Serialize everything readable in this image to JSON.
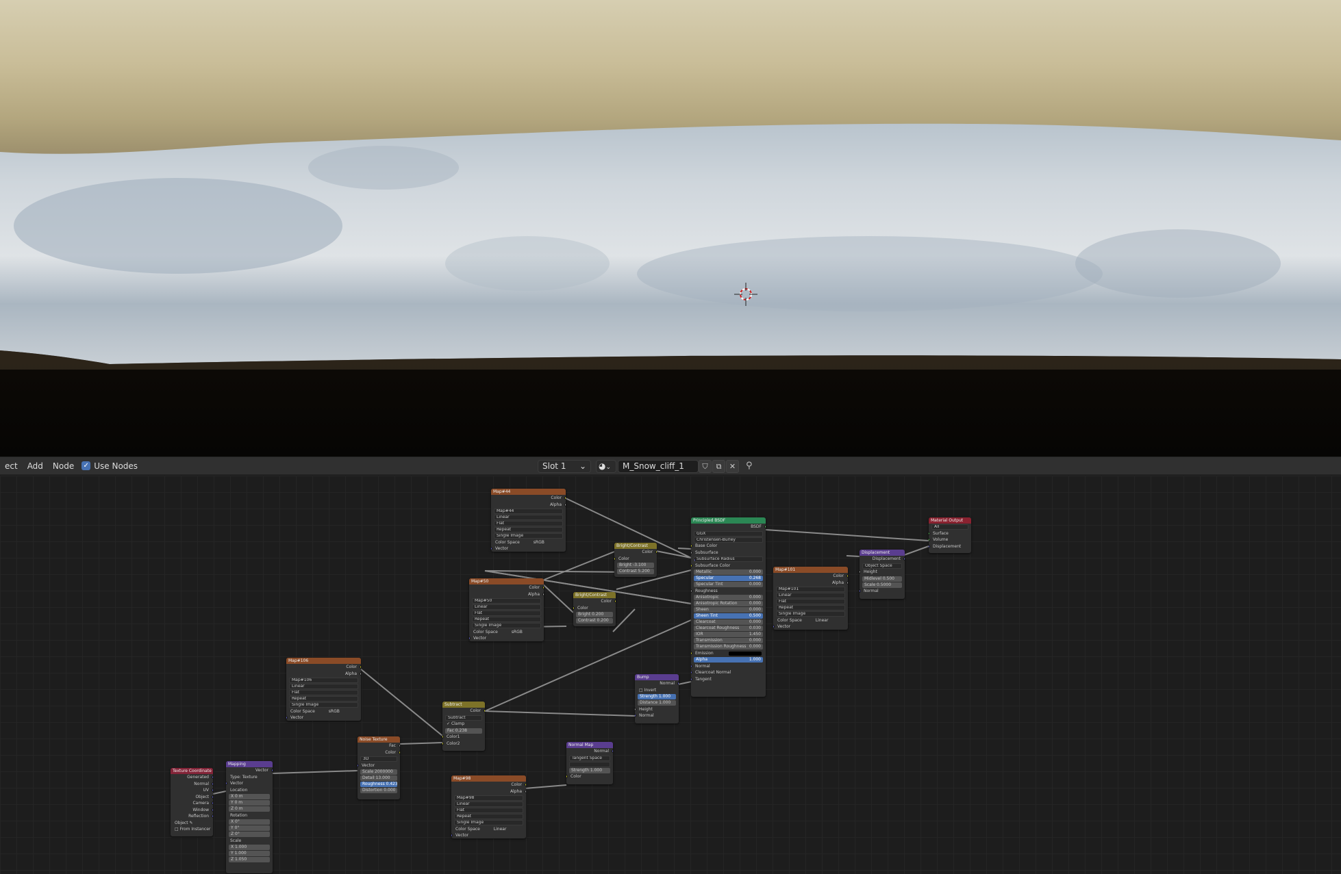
{
  "header": {
    "menu": [
      "ect",
      "Add",
      "Node"
    ],
    "use_nodes_label": "Use Nodes",
    "slot_label": "Slot 1",
    "material_name": "M_Snow_cliff_1"
  },
  "nodes": {
    "map44": {
      "title": "Map#44",
      "image": "Map#44",
      "interp": "Linear",
      "proj": "Flat",
      "ext": "Repeat",
      "src": "Single Image",
      "cs_label": "Color Space",
      "cs": "sRGB",
      "out1": "Color",
      "out2": "Alpha",
      "in": "Vector"
    },
    "map50": {
      "title": "Map#50",
      "image": "Map#50",
      "interp": "Linear",
      "proj": "Flat",
      "ext": "Repeat",
      "src": "Single Image",
      "cs_label": "Color Space",
      "cs": "sRGB",
      "out1": "Color",
      "out2": "Alpha",
      "in": "Vector"
    },
    "map106": {
      "title": "Map#106",
      "image": "Map#106",
      "interp": "Linear",
      "proj": "Flat",
      "ext": "Repeat",
      "src": "Single Image",
      "cs_label": "Color Space",
      "cs": "sRGB",
      "out1": "Color",
      "out2": "Alpha",
      "in": "Vector"
    },
    "map101": {
      "title": "Map#101",
      "image": "Map#101",
      "interp": "Linear",
      "proj": "Flat",
      "ext": "Repeat",
      "src": "Single Image",
      "cs_label": "Color Space",
      "cs": "Linear",
      "out1": "Color",
      "out2": "Alpha",
      "in": "Vector"
    },
    "map98": {
      "title": "Map#98",
      "image": "Map#98",
      "interp": "Linear",
      "proj": "Flat",
      "ext": "Repeat",
      "src": "Single Image",
      "cs_label": "Color Space",
      "cs": "Linear",
      "out1": "Color",
      "out2": "Alpha",
      "in": "Vector"
    },
    "bc1": {
      "title": "Bright/Contrast",
      "out": "Color",
      "in": "Color",
      "bright": "Bright -3.100",
      "contrast": "Contrast 5.200"
    },
    "bc2": {
      "title": "Bright/Contrast",
      "out": "Color",
      "in": "Color",
      "bright": "Bright 0.200",
      "contrast": "Contrast 0.200"
    },
    "bsdf": {
      "title": "Principled BSDF",
      "out": "BSDF",
      "dist": "GGX",
      "sss": "Christensen-Burley",
      "rows": [
        "Base Color",
        "Subsurface",
        "Subsurface Radius",
        "Subsurface Color"
      ],
      "fields": [
        {
          "label": "Metallic",
          "value": "0.000"
        },
        {
          "label": "Specular",
          "value": "0.268"
        },
        {
          "label": "Specular Tint",
          "value": "0.000"
        }
      ],
      "rough": "Roughness",
      "fields2": [
        {
          "label": "Anisotropic",
          "value": "0.000"
        },
        {
          "label": "Anisotropic Rotation",
          "value": "0.000"
        },
        {
          "label": "Sheen",
          "value": "0.000"
        },
        {
          "label": "Sheen Tint",
          "value": "0.500"
        },
        {
          "label": "Clearcoat",
          "value": "0.000"
        },
        {
          "label": "Clearcoat Roughness",
          "value": "0.030"
        },
        {
          "label": "IOR",
          "value": "1.450"
        },
        {
          "label": "Transmission",
          "value": "0.000"
        },
        {
          "label": "Transmission Roughness",
          "value": "0.000"
        }
      ],
      "emission": "Emission",
      "alpha": "Alpha",
      "alpha_val": "1.000",
      "tail": [
        "Normal",
        "Clearcoat Normal",
        "Tangent"
      ]
    },
    "output": {
      "title": "Material Output",
      "target": "All",
      "rows": [
        "Surface",
        "Volume",
        "Displacement"
      ]
    },
    "disp": {
      "title": "Displacement",
      "out": "Displacement",
      "space": "Object Space",
      "height": "Height",
      "mid": "Midlevel 0.500",
      "scale": "Scale 0.5000",
      "normal": "Normal"
    },
    "bump": {
      "title": "Bump",
      "out": "Normal",
      "invert": "Invert",
      "strength": "Strength 1.000",
      "distance": "Distance 1.000",
      "height": "Height",
      "normal": "Normal"
    },
    "subtract": {
      "title": "Subtract",
      "out": "Color",
      "mode": "Subtract",
      "clamp": "Clamp",
      "fac": "Fac 0.238",
      "c1": "Color1",
      "c2": "Color2"
    },
    "normalmap": {
      "title": "Normal Map",
      "out": "Normal",
      "space": "Tangent Space",
      "strength": "Strength 1.000",
      "in": "Color"
    },
    "noise": {
      "title": "Noise Texture",
      "out1": "Fac",
      "out2": "Color",
      "dim": "3D",
      "in": "Vector",
      "scale": "Scale 2000000",
      "detail": "Detail 13.000",
      "rough": "Roughness 0.423",
      "dist": "Distortion 0.000"
    },
    "mapping": {
      "title": "Mapping",
      "out": "Vector",
      "type_label": "Type:",
      "type": "Texture",
      "vec": "Vector",
      "loc": "Location",
      "locv": [
        "X 0 m",
        "Y 0 m",
        "Z 0 m"
      ],
      "rot": "Rotation",
      "rotv": [
        "X 0°",
        "Y 0°",
        "Z 0°"
      ],
      "sc": "Scale",
      "scv": [
        "X 1.000",
        "Y 1.000",
        "Z 1.050"
      ]
    },
    "texcoord": {
      "title": "Texture Coordinate",
      "outs": [
        "Generated",
        "Normal",
        "UV",
        "Object",
        "Camera",
        "Window",
        "Reflection"
      ],
      "object": "Object",
      "from": "From Instancer"
    }
  }
}
